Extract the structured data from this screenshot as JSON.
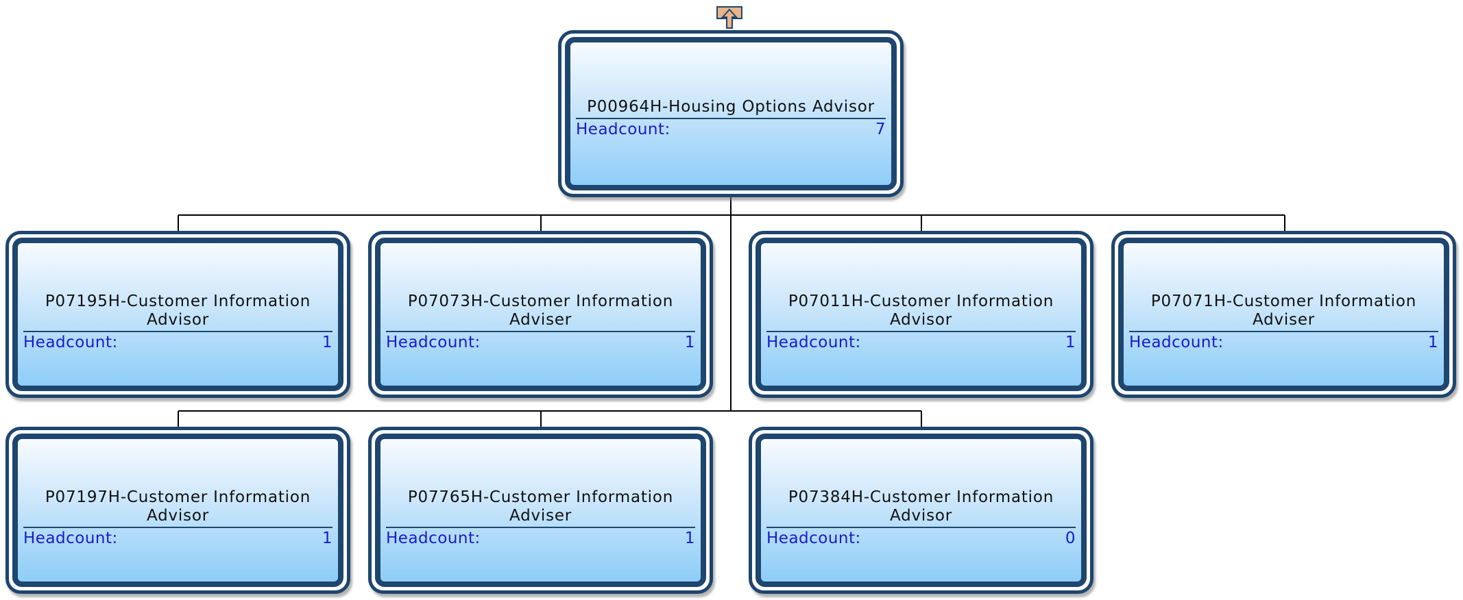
{
  "colors": {
    "node_border": "#1e466e",
    "gradient_top": "#f7fbff",
    "gradient_bottom": "#8ecdf8",
    "metric_text": "#1a1acc",
    "title_text": "#111111",
    "connector": "#000000",
    "collapse_fill": "#e8b48a"
  },
  "collapse_button": {
    "icon": "up-arrow-icon"
  },
  "root": {
    "title": "P00964H-Housing Options Advisor",
    "metric_label": "Headcount:",
    "metric_value": "7"
  },
  "children": [
    {
      "title": "P07195H-Customer Information Advisor",
      "metric_label": "Headcount:",
      "metric_value": "1"
    },
    {
      "title": "P07073H-Customer Information Adviser",
      "metric_label": "Headcount:",
      "metric_value": "1"
    },
    {
      "title": "P07011H-Customer Information Advisor",
      "metric_label": "Headcount:",
      "metric_value": "1"
    },
    {
      "title": "P07071H-Customer Information Adviser",
      "metric_label": "Headcount:",
      "metric_value": "1"
    },
    {
      "title": "P07197H-Customer Information Advisor",
      "metric_label": "Headcount:",
      "metric_value": "1"
    },
    {
      "title": "P07765H-Customer Information Adviser",
      "metric_label": "Headcount:",
      "metric_value": "1"
    },
    {
      "title": "P07384H-Customer Information Advisor",
      "metric_label": "Headcount:",
      "metric_value": "0"
    }
  ]
}
